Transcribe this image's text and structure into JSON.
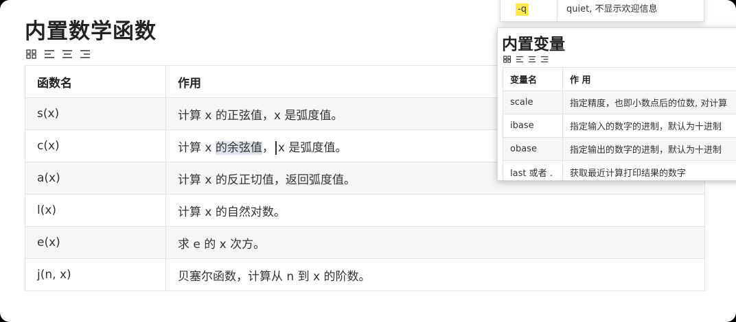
{
  "page": {
    "title": "内置数学函数"
  },
  "toolbar_icons": [
    "grid-icon",
    "align-left-icon",
    "align-center-icon",
    "align-right-icon"
  ],
  "main_table": {
    "headers": [
      "函数名",
      "作用"
    ],
    "rows": [
      {
        "name": "s(x)",
        "desc": "计算 x 的正弦值，x 是弧度值。"
      },
      {
        "name": "c(x)",
        "desc_a": "计算 x ",
        "desc_hl": "的余弦值",
        "desc_b": "，",
        "desc_c": "x 是弧度值。"
      },
      {
        "name": "a(x)",
        "desc": "计算 x 的反正切值，返回弧度值。"
      },
      {
        "name": "l(x)",
        "desc": "计算 x 的自然对数。"
      },
      {
        "name": "e(x)",
        "desc": "求 e 的 x 次方。"
      },
      {
        "name": "j(n, x)",
        "desc": "贝塞尔函数，计算从 n 到 x 的阶数。"
      }
    ]
  },
  "options_popup": {
    "flag": "-q",
    "desc": "quiet, 不显示欢迎信息"
  },
  "vars_popup": {
    "title": "内置变量",
    "headers": [
      "变量名",
      "作 用"
    ],
    "rows": [
      {
        "name": "scale",
        "desc": "指定精度，也即小数点后的位数, 对计算"
      },
      {
        "name": "ibase",
        "desc": "指定输入的数字的进制，默认为十进制"
      },
      {
        "name": "obase",
        "desc": "指定输出的数字的进制，默认为十进制"
      },
      {
        "name": "last 或者 .",
        "desc": "获取最近计算打印结果的数字"
      }
    ]
  }
}
